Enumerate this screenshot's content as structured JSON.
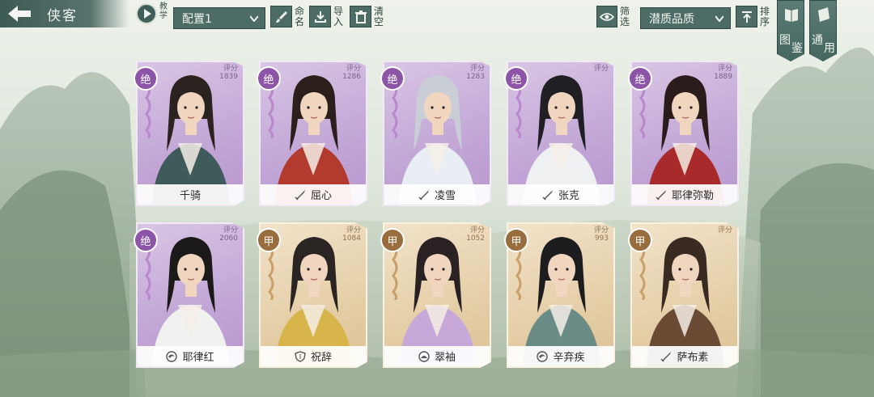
{
  "header": {
    "title": "侠客",
    "teach_label": "教学",
    "config_select": "配置1",
    "rename_label": "命名",
    "import_label": "导入",
    "clear_label": "清空",
    "filter_label": "筛选",
    "quality_select": "潜质品质",
    "sort_label": "排序",
    "codex_label_a": "图",
    "codex_label_b": "鉴",
    "general_label_a": "通",
    "general_label_b": "用"
  },
  "score_label": "评分",
  "cards": [
    {
      "name": "千骑",
      "grade": "绝",
      "score": "1839",
      "tier": "purple",
      "class_icon": "none",
      "robe": "#3f5a5a",
      "hair": "#2a2320"
    },
    {
      "name": "屈心",
      "grade": "绝",
      "score": "1286",
      "tier": "purple",
      "class_icon": "sword-icon",
      "robe": "#b23a2e",
      "hair": "#2b1f1c"
    },
    {
      "name": "凌雪",
      "grade": "绝",
      "score": "1283",
      "tier": "purple",
      "class_icon": "sword-icon",
      "robe": "#e8eef4",
      "hair": "#c9ced6"
    },
    {
      "name": "张克",
      "grade": "绝",
      "score": "",
      "tier": "purple",
      "class_icon": "sword-icon",
      "robe": "#eef0f2",
      "hair": "#1f1f24"
    },
    {
      "name": "耶律弥勒",
      "grade": "绝",
      "score": "1889",
      "tier": "purple",
      "class_icon": "sword-icon",
      "robe": "#a82a2a",
      "hair": "#2a1c1a"
    },
    {
      "name": "耶律红",
      "grade": "绝",
      "score": "2060",
      "tier": "purple",
      "class_icon": "swirl-icon",
      "robe": "#f1f1ef",
      "hair": "#1c1a19"
    },
    {
      "name": "祝辞",
      "grade": "甲",
      "score": "1084",
      "tier": "gold",
      "class_icon": "shield-icon",
      "robe": "#d8b54a",
      "hair": "#2a2422"
    },
    {
      "name": "翠袖",
      "grade": "甲",
      "score": "1052",
      "tier": "gold",
      "class_icon": "lotus-icon",
      "robe": "#c7a8d8",
      "hair": "#2a2222"
    },
    {
      "name": "辛弃疾",
      "grade": "甲",
      "score": "993",
      "tier": "gold",
      "class_icon": "swirl-icon",
      "robe": "#6b8c86",
      "hair": "#1d1d20"
    },
    {
      "name": "萨布素",
      "grade": "甲",
      "score": "",
      "tier": "gold",
      "class_icon": "sword-icon",
      "robe": "#6b4a34",
      "hair": "#3a2b22"
    }
  ]
}
